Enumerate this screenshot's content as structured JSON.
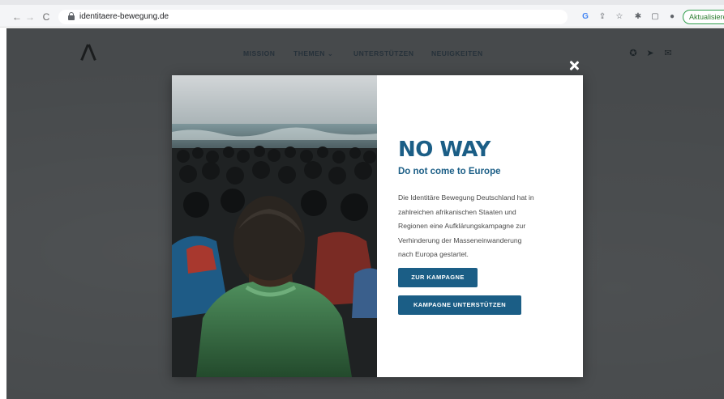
{
  "browser": {
    "url": "identitaere-bewegung.de",
    "update_label": "Aktualisieren",
    "icons": [
      "back-icon",
      "forward-icon",
      "reload-icon",
      "lock-icon",
      "google-icon",
      "share-icon",
      "star-icon",
      "extensions-icon",
      "split-view-icon",
      "profile-icon"
    ]
  },
  "site": {
    "nav": {
      "mission": "MISSION",
      "themen": "THEMEN ⌄",
      "unterstuetzen": "UNTERSTÜTZEN",
      "neuigkeiten": "NEUIGKEITEN"
    },
    "social_icons": [
      "odysee-icon",
      "telegram-icon",
      "mail-icon"
    ]
  },
  "modal": {
    "headline": "NO WAY",
    "subheadline": "Do not come to Europe",
    "body_lines": [
      "Die Identitäre Bewegung Deutschland hat in",
      "zahlreichen afrikanischen Staaten und",
      "Regionen eine Aufklärungskampagne zur",
      "Verhinderung der Masseneinwanderung",
      "nach Europa gestartet."
    ],
    "button_primary": "ZUR KAMPAGNE",
    "button_secondary": "KAMPAGNE UNTERSTÜTZEN",
    "accent_color": "#1b5e86"
  }
}
